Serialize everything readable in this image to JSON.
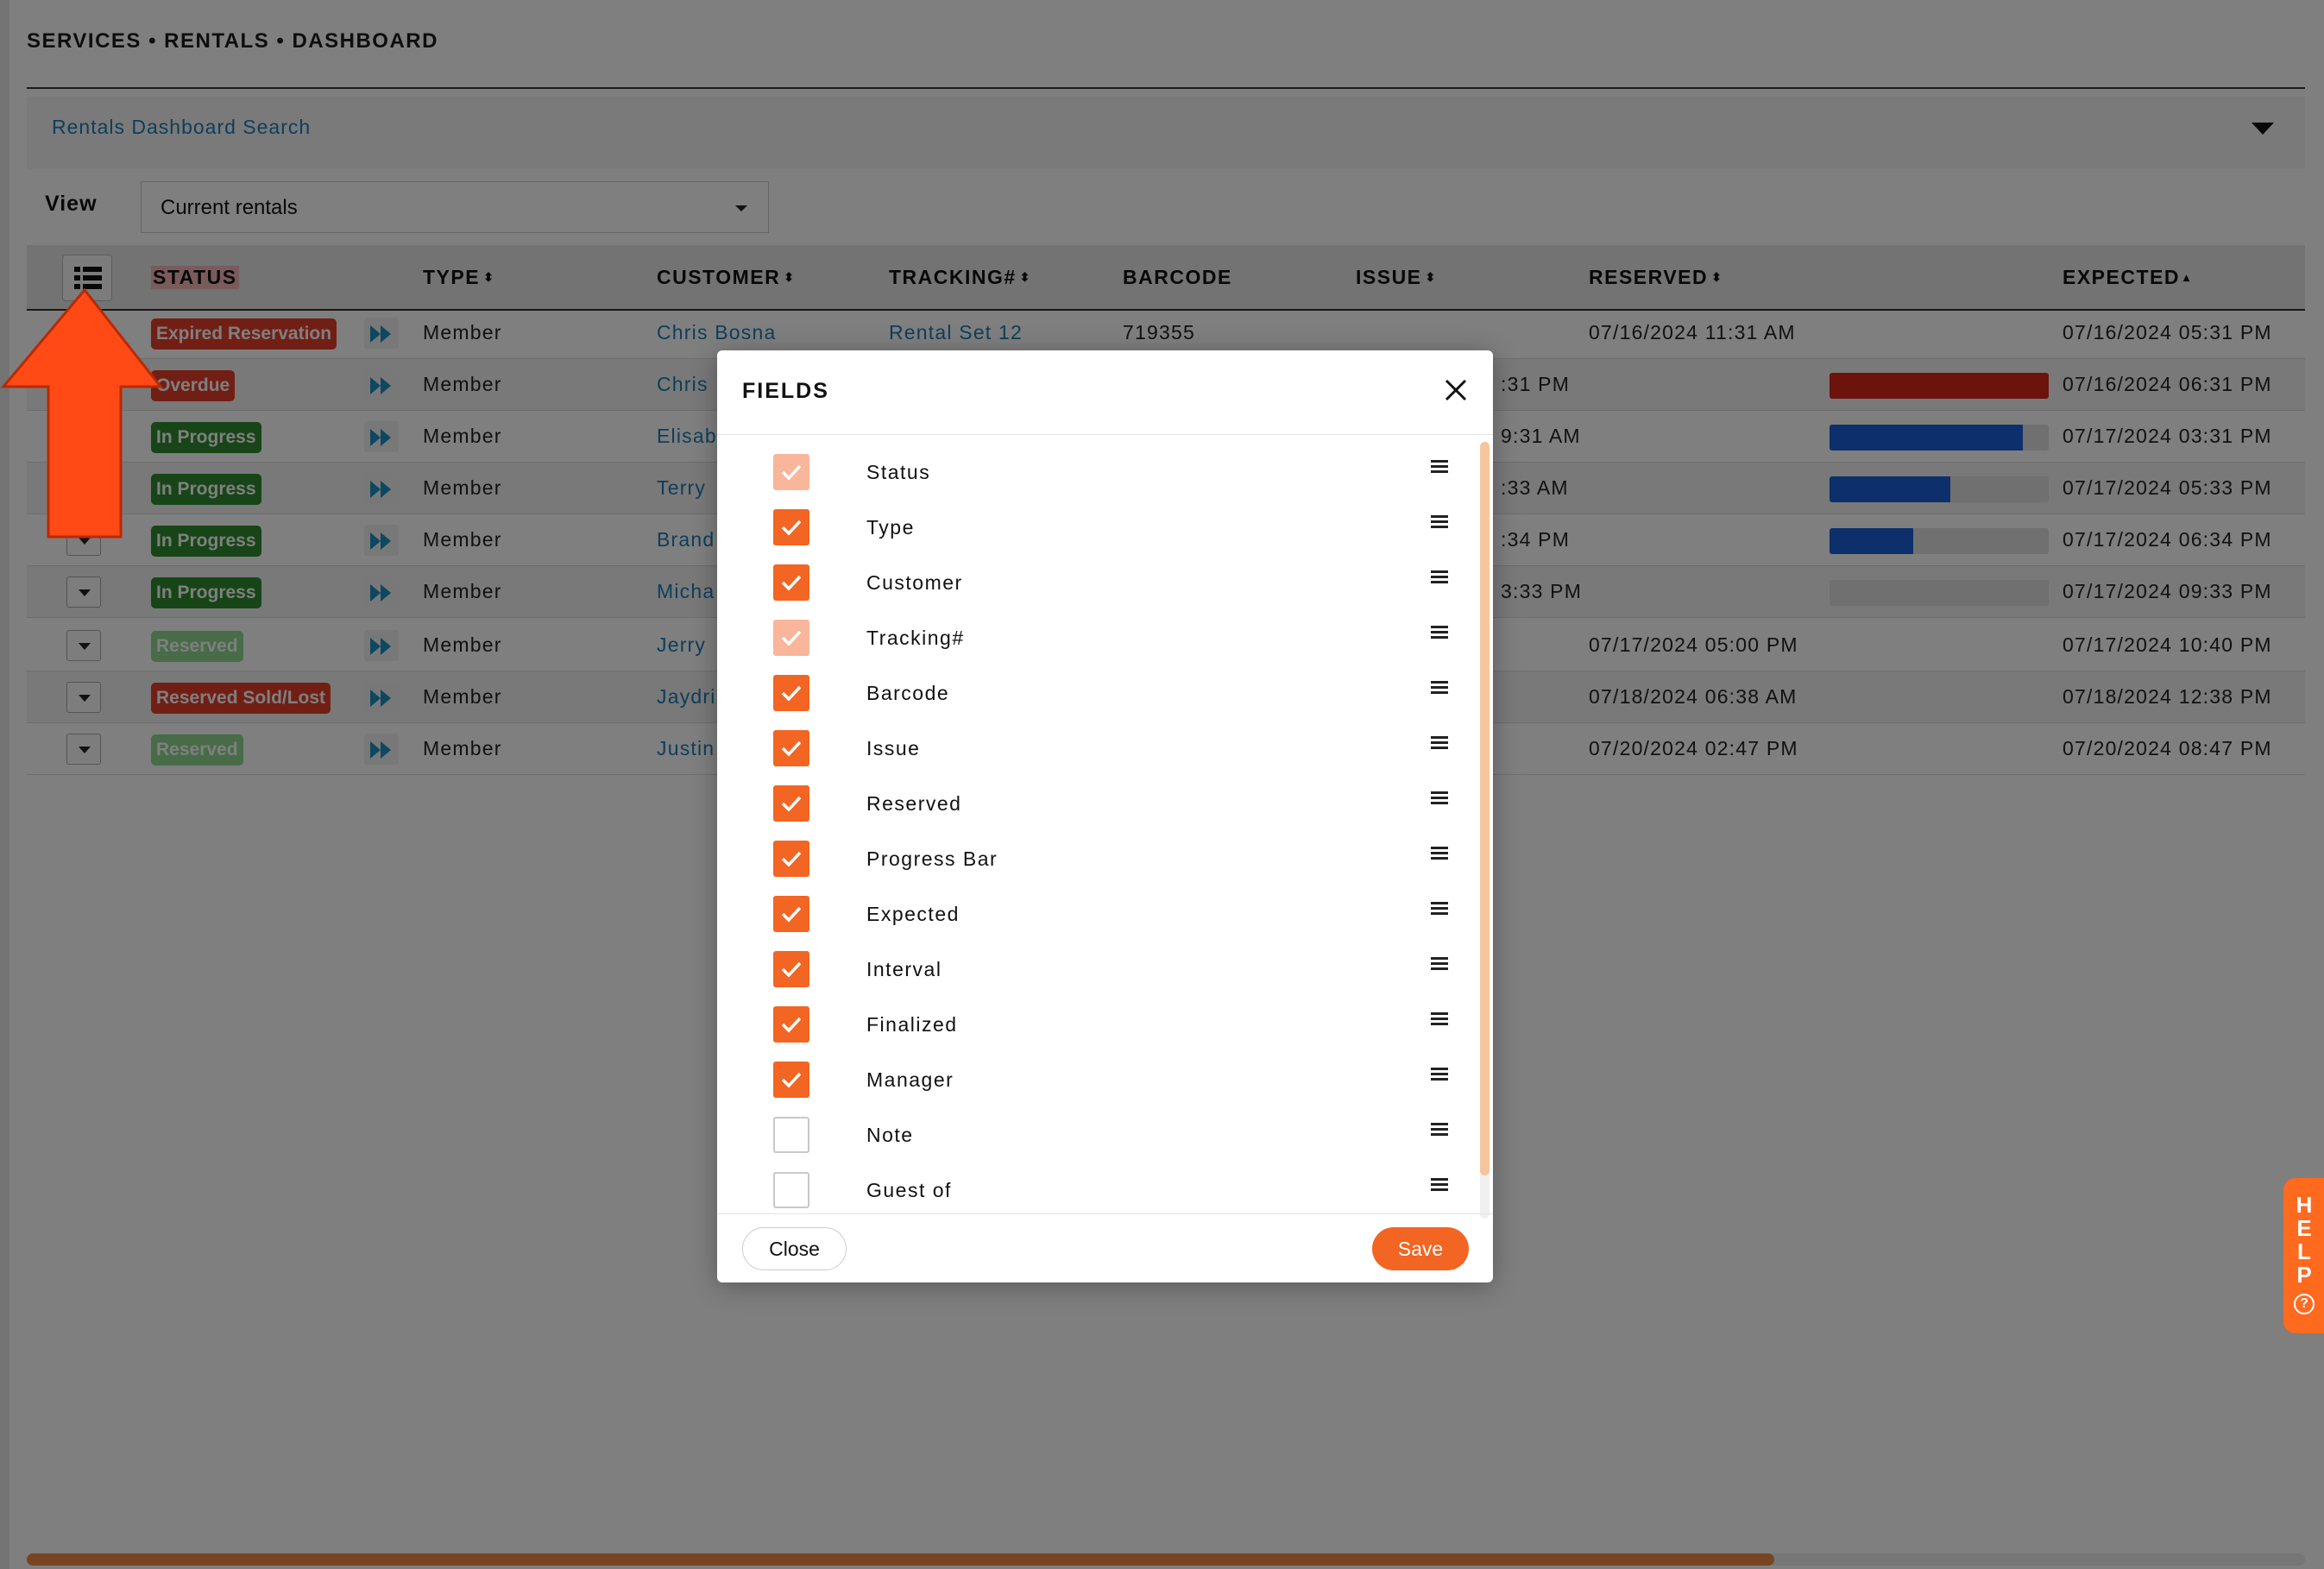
{
  "breadcrumb": "SERVICES • RENTALS • DASHBOARD",
  "search": {
    "label": "Rentals Dashboard Search"
  },
  "view": {
    "label": "View",
    "selected": "Current rentals"
  },
  "table": {
    "headers": {
      "status": "STATUS",
      "type": "TYPE",
      "customer": "CUSTOMER",
      "tracking": "TRACKING#",
      "barcode": "BARCODE",
      "issue": "ISSUE",
      "reserved": "RESERVED",
      "expected": "EXPECTED",
      "sort_both": "⬍",
      "sort_up": "▴"
    },
    "rows": [
      {
        "status": "Expired Reservation",
        "status_color": "#e23e2b",
        "type": "Member",
        "customer": "Chris Bosna",
        "tracking": "Rental Set 12",
        "barcode": "719355",
        "reserved": "07/16/2024 11:31 AM",
        "expected": "07/16/2024 05:31 PM",
        "progress": null
      },
      {
        "status": "Overdue",
        "status_color": "#e23e2b",
        "type": "Member",
        "customer": "Chris",
        "reserved": ":31 PM",
        "expected": "07/16/2024 06:31 PM",
        "progress": 1.0,
        "progress_color": "#d8261a"
      },
      {
        "status": "In Progress",
        "status_color": "#2e8b2e",
        "type": "Member",
        "customer": "Elisab",
        "reserved": "9:31 AM",
        "expected": "07/17/2024 03:31 PM",
        "progress": 0.88,
        "progress_color": "#1a5fd6"
      },
      {
        "status": "In Progress",
        "status_color": "#2e8b2e",
        "type": "Member",
        "customer": "Terry",
        "reserved": ":33 AM",
        "expected": "07/17/2024 05:33 PM",
        "progress": 0.55,
        "progress_color": "#1a5fd6"
      },
      {
        "status": "In Progress",
        "status_color": "#2e8b2e",
        "type": "Member",
        "customer": "Brand",
        "reserved": ":34 PM",
        "expected": "07/17/2024 06:34 PM",
        "progress": 0.38,
        "progress_color": "#1a5fd6"
      },
      {
        "status": "In Progress",
        "status_color": "#2e8b2e",
        "type": "Member",
        "customer": "Micha",
        "reserved": "3:33 PM",
        "expected": "07/17/2024 09:33 PM",
        "progress": 0.0,
        "progress_color": "#1a5fd6"
      },
      {
        "status": "Reserved",
        "status_color": "#8fd88f",
        "type": "Member",
        "customer": "Jerry",
        "reserved": "07/17/2024 05:00 PM",
        "expected": "07/17/2024 10:40 PM",
        "progress": null
      },
      {
        "status": "Reserved Sold/Lost",
        "status_color": "#e23e2b",
        "type": "Member",
        "customer": "Jaydri",
        "reserved": "07/18/2024 06:38 AM",
        "expected": "07/18/2024 12:38 PM",
        "progress": null
      },
      {
        "status": "Reserved",
        "status_color": "#8fd88f",
        "type": "Member",
        "customer": "Justin",
        "reserved": "07/20/2024 02:47 PM",
        "expected": "07/20/2024 08:47 PM",
        "progress": null
      }
    ]
  },
  "modal": {
    "title": "FIELDS",
    "fields": [
      {
        "label": "Status",
        "state": "locked"
      },
      {
        "label": "Type",
        "state": "checked"
      },
      {
        "label": "Customer",
        "state": "checked"
      },
      {
        "label": "Tracking#",
        "state": "locked"
      },
      {
        "label": "Barcode",
        "state": "checked"
      },
      {
        "label": "Issue",
        "state": "checked"
      },
      {
        "label": "Reserved",
        "state": "checked"
      },
      {
        "label": "Progress Bar",
        "state": "checked"
      },
      {
        "label": "Expected",
        "state": "checked"
      },
      {
        "label": "Interval",
        "state": "checked"
      },
      {
        "label": "Finalized",
        "state": "checked"
      },
      {
        "label": "Manager",
        "state": "checked"
      },
      {
        "label": "Note",
        "state": "unchecked"
      },
      {
        "label": "Guest of",
        "state": "unchecked"
      }
    ],
    "close_label": "Close",
    "save_label": "Save"
  },
  "help": {
    "letters": "HELP",
    "q": "?"
  },
  "colors": {
    "accent": "#f26522",
    "link": "#1c7cb6"
  }
}
